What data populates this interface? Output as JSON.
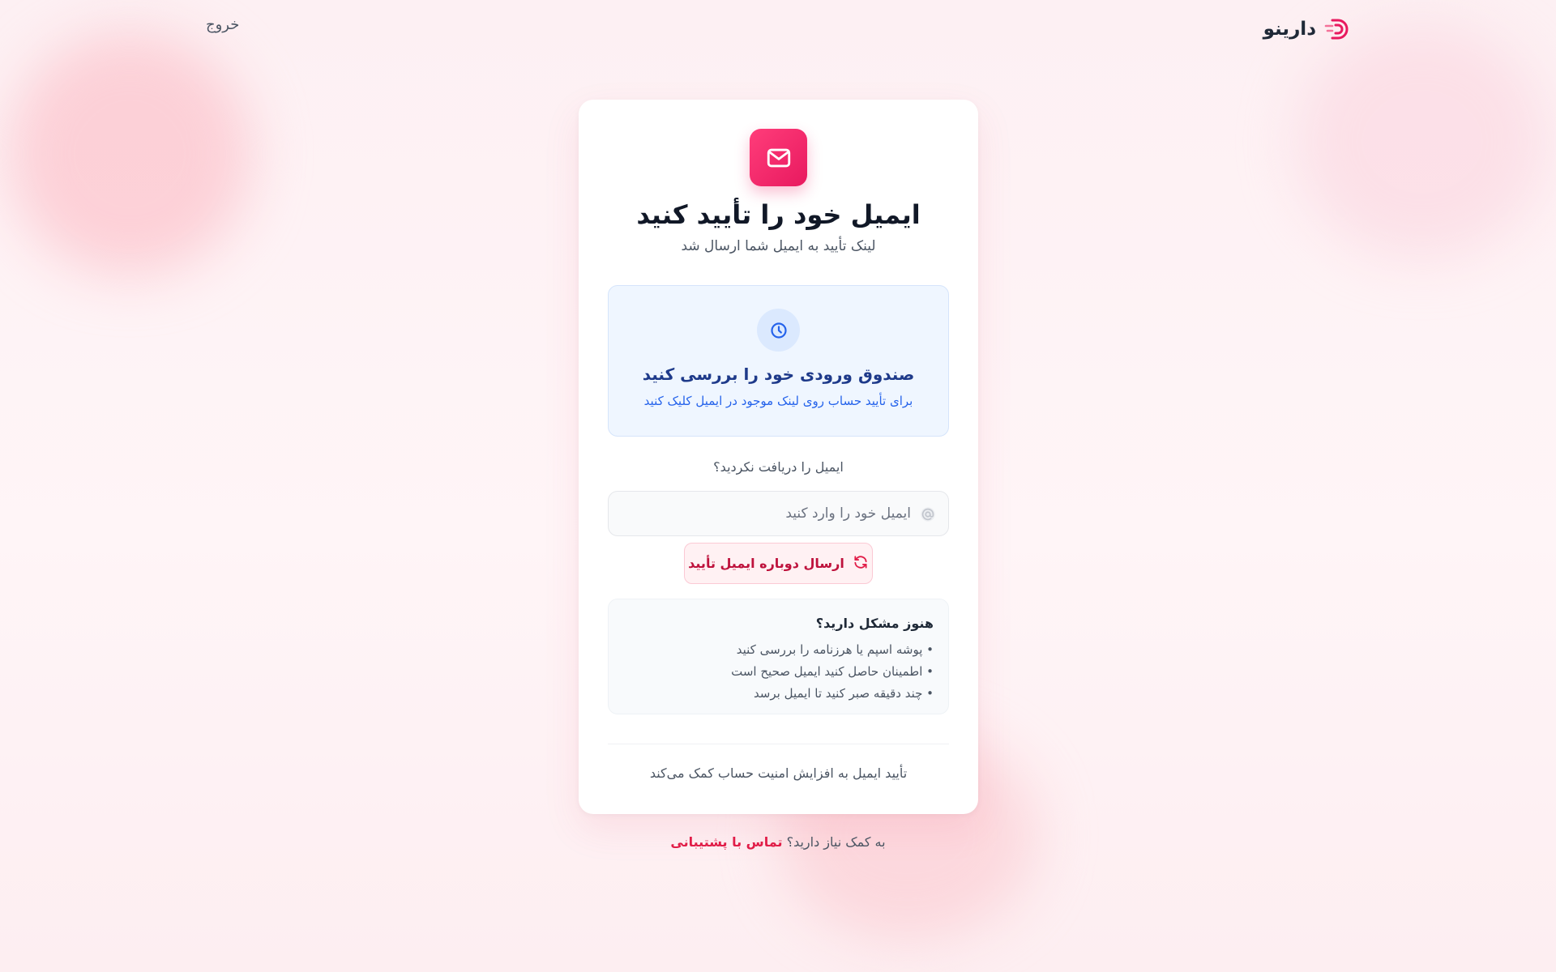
{
  "brand": {
    "name": "دارینو",
    "logo_icon": "darino-logo-icon",
    "accent": "#e8195f"
  },
  "header": {
    "logout_label": "خروج"
  },
  "card": {
    "hero_icon": "mail-icon",
    "title": "ایمیل خود را تأیید کنید",
    "subtitle": "لینک تأیید به ایمیل شما ارسال شد",
    "info": {
      "icon": "clock-icon",
      "title": "صندوق ورودی خود را بررسی کنید",
      "description": "برای تأیید حساب روی لینک موجود در ایمیل کلیک کنید"
    },
    "not_received": "ایمیل را دریافت نکردید؟",
    "email_input": {
      "placeholder": "ایمیل خود را وارد کنید",
      "value": "",
      "icon": "at-sign-icon"
    },
    "resend_button": {
      "label": "ارسال دوباره ایمیل تأیید",
      "icon": "refresh-icon"
    },
    "help": {
      "title": "هنوز مشکل دارید؟",
      "items": [
        "• پوشه اسپم یا هرزنامه را بررسی کنید",
        "• اطمینان حاصل کنید ایمیل صحیح است",
        "• چند دقیقه صبر کنید تا ایمیل برسد"
      ]
    },
    "footer_note": "تأیید ایمیل به افزایش امنیت حساب کمک می‌کند"
  },
  "support": {
    "prompt": "به کمک نیاز دارید؟",
    "link_label": "تماس با پشتیبانی"
  }
}
